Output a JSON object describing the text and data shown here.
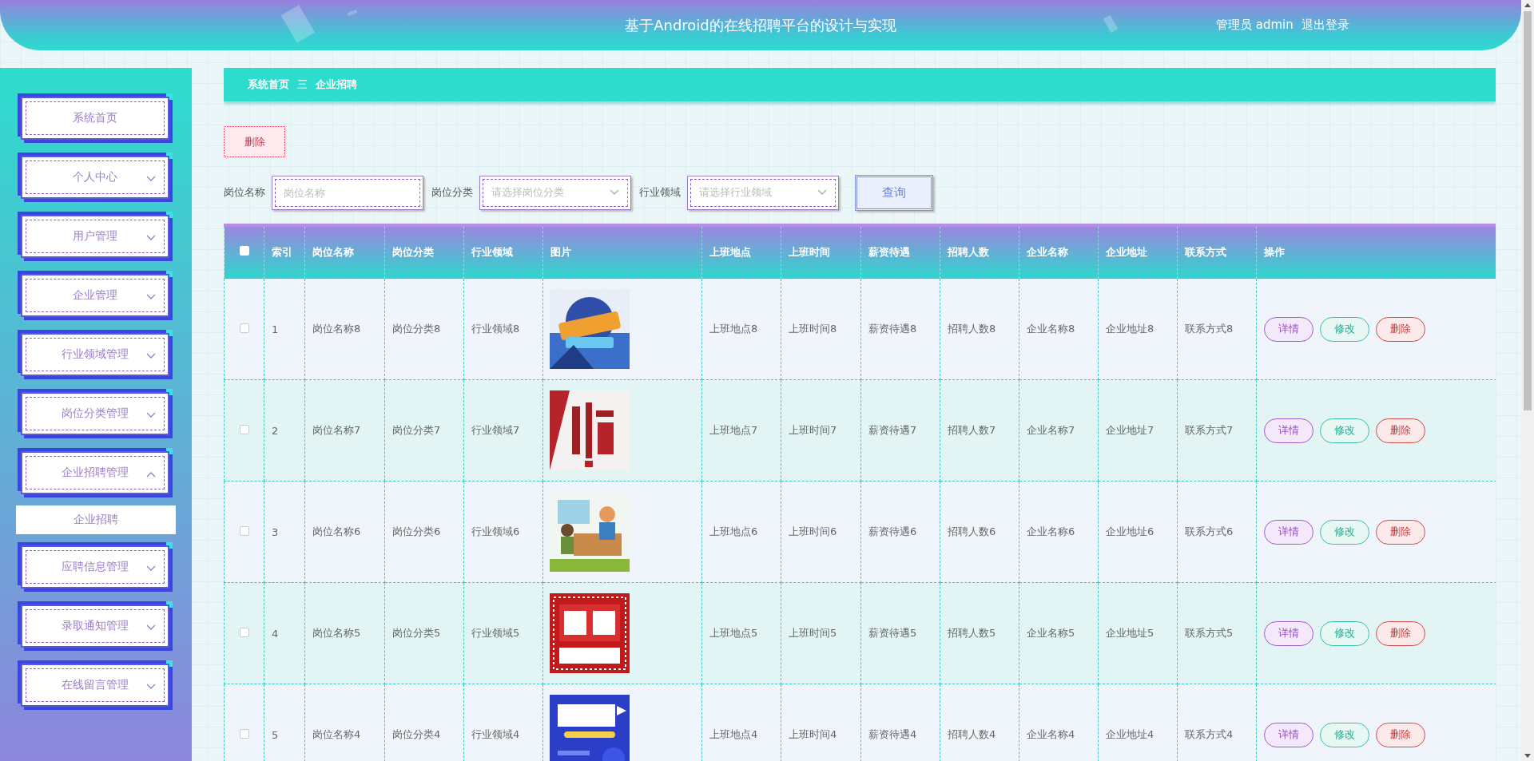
{
  "header": {
    "title": "基于Android的在线招聘平台的设计与实现",
    "user": "管理员 admin",
    "logout": "退出登录"
  },
  "sidebar": {
    "items": [
      {
        "label": "系统首页",
        "kind": "link"
      },
      {
        "label": "个人中心",
        "kind": "menu",
        "expanded": false
      },
      {
        "label": "用户管理",
        "kind": "menu",
        "expanded": false
      },
      {
        "label": "企业管理",
        "kind": "menu",
        "expanded": false
      },
      {
        "label": "行业领域管理",
        "kind": "menu",
        "expanded": false
      },
      {
        "label": "岗位分类管理",
        "kind": "menu",
        "expanded": false
      },
      {
        "label": "企业招聘管理",
        "kind": "menu",
        "expanded": true,
        "children": [
          {
            "label": "企业招聘"
          }
        ]
      },
      {
        "label": "应聘信息管理",
        "kind": "menu",
        "expanded": false
      },
      {
        "label": "录取通知管理",
        "kind": "menu",
        "expanded": false
      },
      {
        "label": "在线留言管理",
        "kind": "menu",
        "expanded": false
      }
    ]
  },
  "breadcrumb": {
    "items": [
      "系统首页",
      "企业招聘"
    ],
    "separator": "三"
  },
  "toolbar": {
    "delete_button": "删除"
  },
  "filters": [
    {
      "label": "岗位名称",
      "kind": "input",
      "placeholder": "岗位名称"
    },
    {
      "label": "岗位分类",
      "kind": "select",
      "placeholder": "请选择岗位分类"
    },
    {
      "label": "行业领域",
      "kind": "select",
      "placeholder": "请选择行业领域"
    }
  ],
  "search_button": "查询",
  "table": {
    "select_all": {
      "checked": false
    },
    "columns": [
      "索引",
      "岗位名称",
      "岗位分类",
      "行业领域",
      "图片",
      "上班地点",
      "上班时间",
      "薪资待遇",
      "招聘人数",
      "企业名称",
      "企业地址",
      "联系方式",
      "操作"
    ],
    "rows": [
      {
        "checked": false,
        "cells": [
          "1",
          "岗位名称8",
          "岗位分类8",
          "行业领域8",
          {
            "kind": "picture"
          },
          "上班地点8",
          "上班时间8",
          "薪资待遇8",
          "招聘人数8",
          "企业名称8",
          "企业地址8",
          "联系方式8"
        ],
        "actions": [
          "详情",
          "修改",
          "删除"
        ]
      },
      {
        "checked": false,
        "cells": [
          "2",
          "岗位名称7",
          "岗位分类7",
          "行业领域7",
          {
            "kind": "picture"
          },
          "上班地点7",
          "上班时间7",
          "薪资待遇7",
          "招聘人数7",
          "企业名称7",
          "企业地址7",
          "联系方式7"
        ],
        "actions": [
          "详情",
          "修改",
          "删除"
        ]
      },
      {
        "checked": false,
        "cells": [
          "3",
          "岗位名称6",
          "岗位分类6",
          "行业领域6",
          {
            "kind": "picture"
          },
          "上班地点6",
          "上班时间6",
          "薪资待遇6",
          "招聘人数6",
          "企业名称6",
          "企业地址6",
          "联系方式6"
        ],
        "actions": [
          "详情",
          "修改",
          "删除"
        ]
      },
      {
        "checked": false,
        "cells": [
          "4",
          "岗位名称5",
          "岗位分类5",
          "行业领域5",
          {
            "kind": "picture"
          },
          "上班地点5",
          "上班时间5",
          "薪资待遇5",
          "招聘人数5",
          "企业名称5",
          "企业地址5",
          "联系方式5"
        ],
        "actions": [
          "详情",
          "修改",
          "删除"
        ]
      },
      {
        "checked": false,
        "cells": [
          "5",
          "岗位名称4",
          "岗位分类4",
          "行业领域4",
          {
            "kind": "picture"
          },
          "上班地点4",
          "上班时间4",
          "薪资待遇4",
          "招聘人数4",
          "企业名称4",
          "企业地址4",
          "联系方式4"
        ],
        "actions": [
          "详情",
          "修改",
          "删除"
        ]
      }
    ]
  }
}
